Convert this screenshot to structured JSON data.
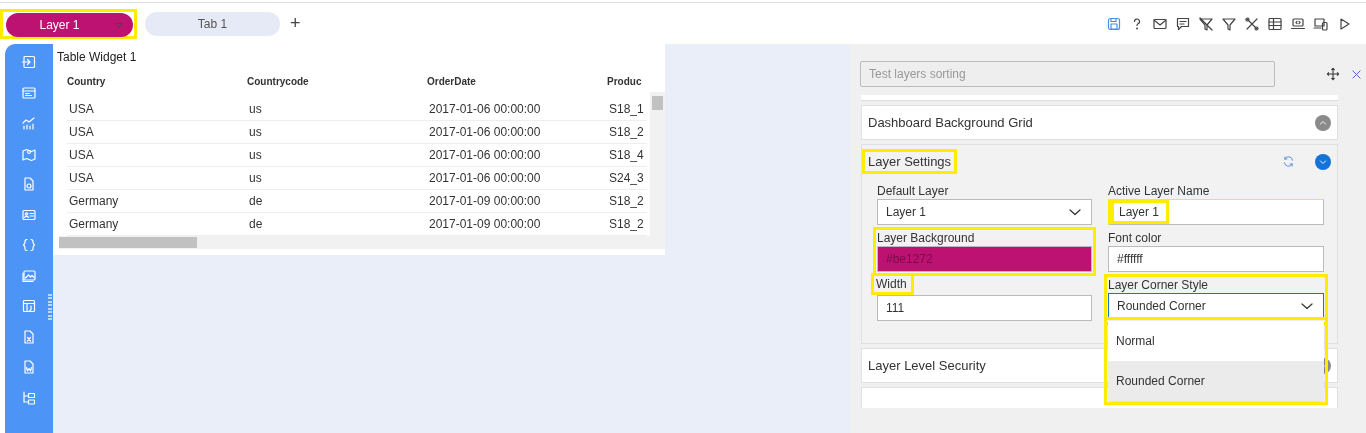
{
  "layer_selector": {
    "label": "Layer 1",
    "highlighted": true
  },
  "tabs": [
    {
      "label": "Tab 1"
    }
  ],
  "add_tab": "+",
  "table_widget": {
    "title": "Table Widget 1",
    "columns": [
      "Country",
      "Countrycode",
      "OrderDate",
      "Produc"
    ],
    "rows": [
      [
        "USA",
        "us",
        "2017-01-06 00:00:00",
        "S18_1"
      ],
      [
        "USA",
        "us",
        "2017-01-06 00:00:00",
        "S18_2"
      ],
      [
        "USA",
        "us",
        "2017-01-06 00:00:00",
        "S18_4"
      ],
      [
        "USA",
        "us",
        "2017-01-06 00:00:00",
        "S24_3"
      ],
      [
        "Germany",
        "de",
        "2017-01-09 00:00:00",
        "S18_2"
      ],
      [
        "Germany",
        "de",
        "2017-01-09 00:00:00",
        "S18_2"
      ]
    ]
  },
  "settings_panel": {
    "search": {
      "placeholder": "Test layers sorting"
    },
    "sections": [
      {
        "title": "Dashboard Background Grid",
        "expanded": false,
        "highlighted": false
      },
      {
        "title": "Layer Settings",
        "expanded": true,
        "highlighted": true,
        "fields": [
          {
            "kind": "select",
            "label": "Default Layer",
            "value": "Layer 1",
            "label_highlighted": false,
            "value_highlighted": false
          },
          {
            "kind": "text",
            "label": "Active Layer Name",
            "value": "Layer 1",
            "label_highlighted": false,
            "value_highlighted": true
          },
          {
            "kind": "color",
            "label": "Layer Background",
            "value": "#be1272",
            "color": "#be1272",
            "label_highlighted": true,
            "value_highlighted": true
          },
          {
            "kind": "text",
            "label": "Font color",
            "value": "#ffffff",
            "label_highlighted": false,
            "value_highlighted": false
          },
          {
            "kind": "text",
            "label": "Width",
            "value": "111",
            "label_highlighted": true,
            "value_highlighted": false
          },
          {
            "kind": "select",
            "label": "Layer Corner Style",
            "value": "Rounded Corner",
            "label_highlighted": true,
            "value_highlighted": true,
            "open": true,
            "options": [
              {
                "label": "Normal",
                "selected": false
              },
              {
                "label": "Rounded Corner",
                "selected": true
              }
            ]
          }
        ]
      },
      {
        "title": "Layer Level Security",
        "expanded": false,
        "highlighted": false
      }
    ]
  }
}
